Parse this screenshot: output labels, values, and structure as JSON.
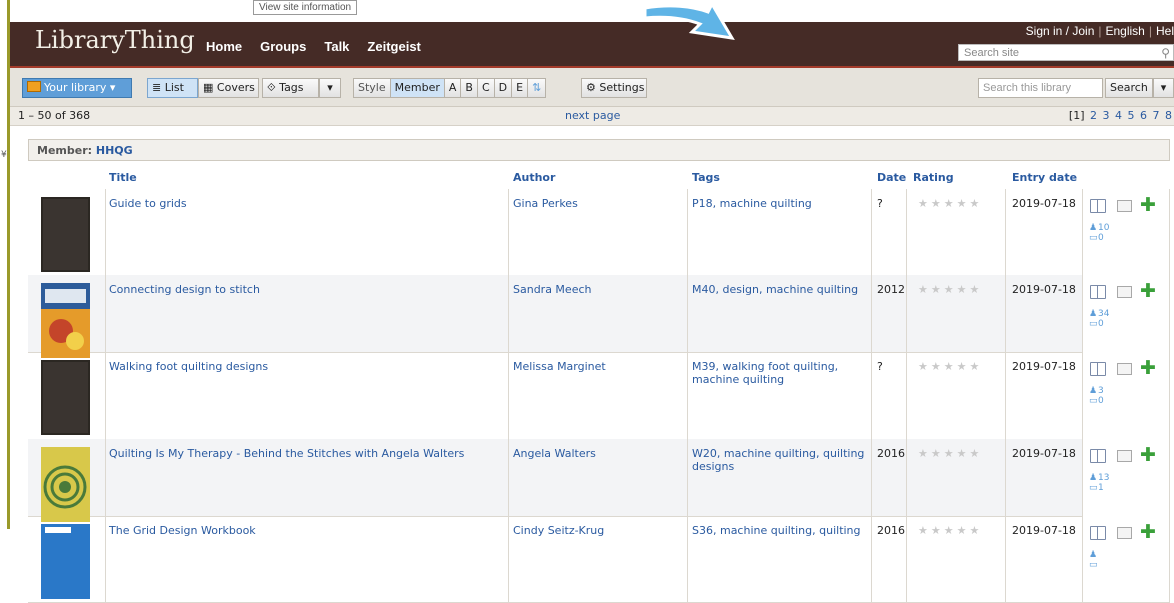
{
  "tooltip": "View site information",
  "header": {
    "logo": "LibraryThing",
    "nav": [
      "Home",
      "Groups",
      "Talk",
      "Zeitgeist"
    ],
    "signin": "Sign in / Join",
    "language": "English",
    "help": "Hel",
    "search_placeholder": "Search site"
  },
  "toolbar": {
    "your_library": "Your library",
    "list": "List",
    "covers": "Covers",
    "tags": "Tags",
    "style": "Style",
    "style_options": [
      "Member",
      "A",
      "B",
      "C",
      "D",
      "E"
    ],
    "settings": "Settings",
    "library_search_placeholder": "Search this library",
    "search": "Search"
  },
  "pager": {
    "range": "1 – 50 of 368",
    "next": "next page",
    "current": "[1]",
    "pages": [
      "2",
      "3",
      "4",
      "5",
      "6",
      "7",
      "8"
    ]
  },
  "member": {
    "label": "Member:",
    "name": "HHQG"
  },
  "columns": {
    "title": "Title",
    "author": "Author",
    "tags": "Tags",
    "date": "Date",
    "rating": "Rating",
    "entry_date": "Entry date"
  },
  "books": [
    {
      "title": "Guide to grids",
      "author": "Gina Perkes",
      "tags": "P18, machine quilting",
      "date": "?",
      "entry_date": "2019-07-18",
      "members": "10",
      "reviews": "0",
      "cover": "dark"
    },
    {
      "title": "Connecting design to stitch",
      "author": "Sandra Meech",
      "tags": "M40, design, machine quilting",
      "date": "2012",
      "entry_date": "2019-07-18",
      "members": "34",
      "reviews": "0",
      "cover": "connecting"
    },
    {
      "title": "Walking foot quilting designs",
      "author": "Melissa Marginet",
      "tags": "M39, walking foot quilting, machine quilting",
      "date": "?",
      "entry_date": "2019-07-18",
      "members": "3",
      "reviews": "0",
      "cover": "dark"
    },
    {
      "title": "Quilting Is My Therapy - Behind the Stitches with Angela Walters",
      "author": "Angela Walters",
      "tags": "W20, machine quilting, quilting designs",
      "date": "2016",
      "entry_date": "2019-07-18",
      "members": "13",
      "reviews": "1",
      "cover": "therapy"
    },
    {
      "title": "The Grid Design Workbook",
      "author": "Cindy Seitz-Krug",
      "tags": "S36, machine quilting, quilting",
      "date": "2016",
      "entry_date": "2019-07-18",
      "members": "",
      "reviews": "",
      "cover": "grid"
    }
  ],
  "colors": {
    "header_bg": "#452b26",
    "link": "#2a5aa0",
    "accent_blue": "#5f9ed8",
    "add_green": "#3aa03a"
  }
}
